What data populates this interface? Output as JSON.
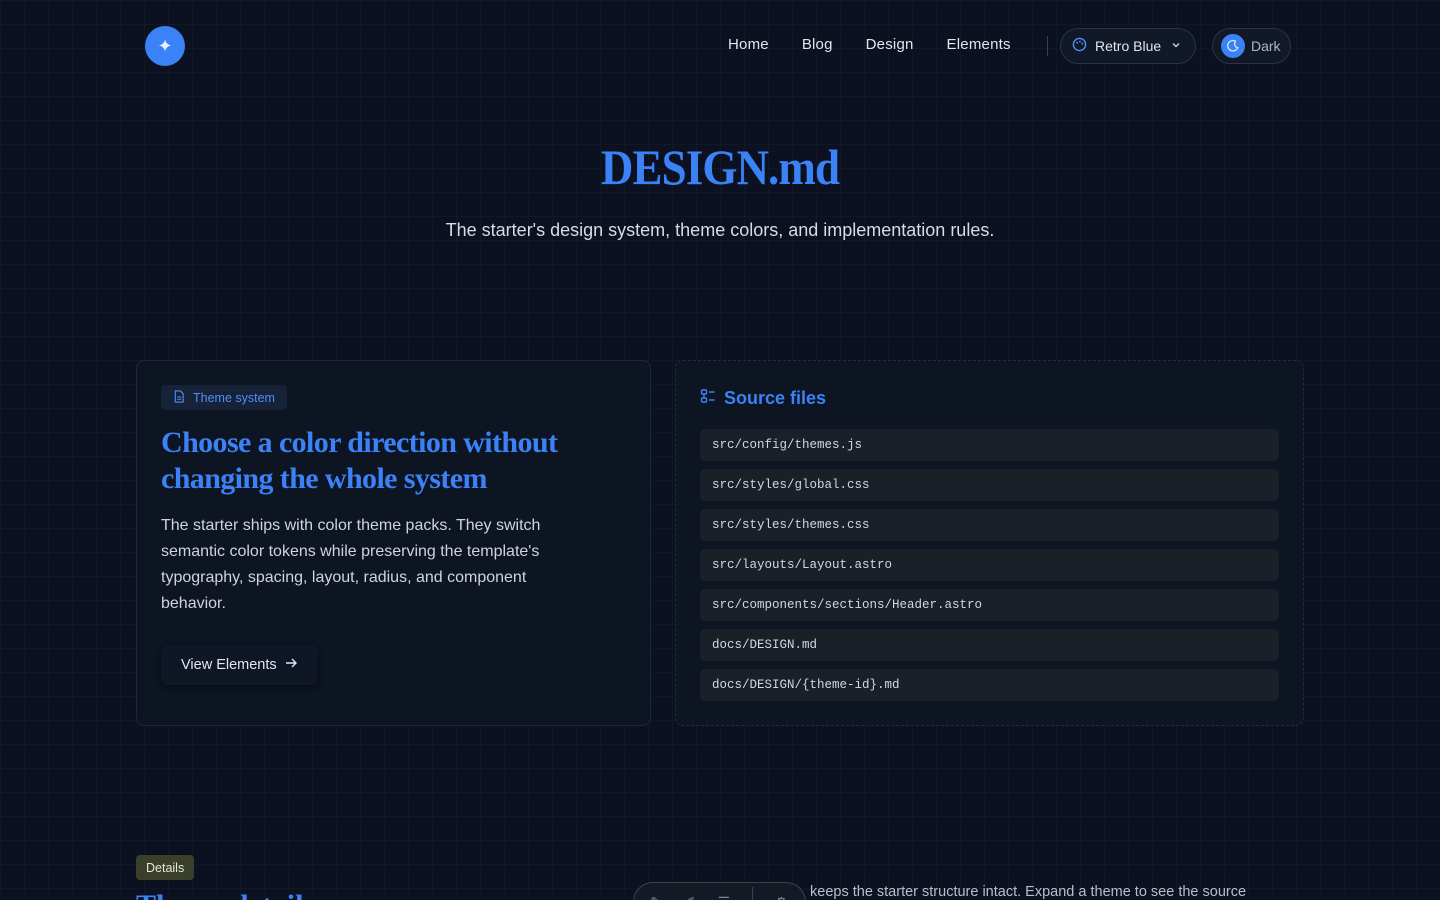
{
  "header": {
    "logo_icon": "sparkle-icon",
    "nav": [
      "Home",
      "Blog",
      "Design",
      "Elements"
    ],
    "theme_select": {
      "icon": "palette-icon",
      "label": "Retro Blue",
      "chevron": "chevron-down-icon"
    },
    "mode_toggle": {
      "icon": "moon-icon",
      "label": "Dark"
    }
  },
  "hero": {
    "title": "DESIGN.md",
    "subtitle": "The starter's design system, theme colors, and implementation rules."
  },
  "theme_card": {
    "badge": "Theme system",
    "title": "Choose a color direction without changing the whole system",
    "body": "The starter ships with color theme packs. They switch semantic color tokens while preserving the template's typography, spacing, layout, radius, and component behavior.",
    "button": "View Elements"
  },
  "source_card": {
    "title": "Source files",
    "files": [
      "src/config/themes.js",
      "src/styles/global.css",
      "src/styles/themes.css",
      "src/layouts/Layout.astro",
      "src/components/sections/Header.astro",
      "docs/DESIGN.md",
      "docs/DESIGN/{theme-id}.md"
    ]
  },
  "details": {
    "badge": "Details",
    "title_partial": "Theme details",
    "text_partial": "keeps the starter structure intact. Expand a theme to see the source"
  },
  "colors": {
    "accent": "#3b82f6",
    "background": "#0b1120"
  }
}
